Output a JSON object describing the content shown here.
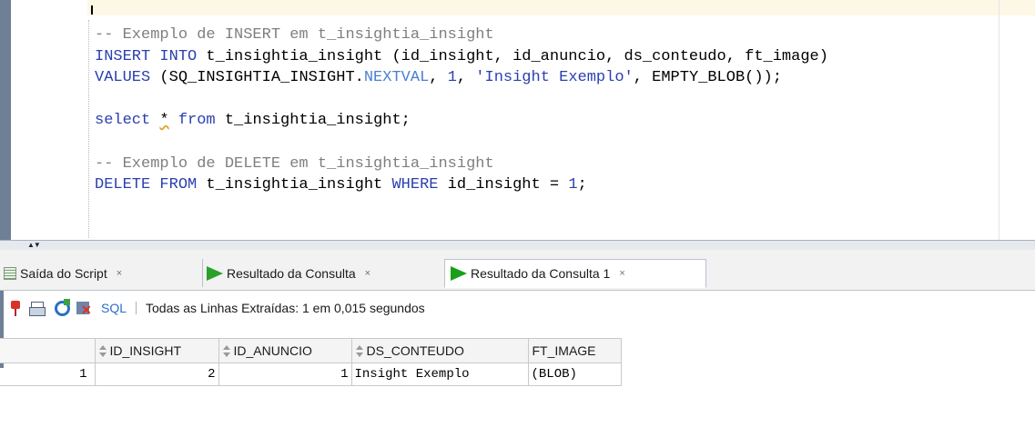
{
  "editor": {
    "lines": [
      [
        {
          "t": "-- Exemplo de INSERT em t_insightia_insight",
          "c": "cm"
        }
      ],
      [
        {
          "t": "INSERT INTO",
          "c": "kw"
        },
        {
          "t": " t_insightia_insight (id_insight, id_anuncio, ds_conteudo, ft_image)",
          "c": ""
        }
      ],
      [
        {
          "t": "VALUES",
          "c": "kw"
        },
        {
          "t": " (SQ_INSIGHTIA_INSIGHT.",
          "c": ""
        },
        {
          "t": "NEXTVAL",
          "c": "fn"
        },
        {
          "t": ", ",
          "c": ""
        },
        {
          "t": "1",
          "c": "num"
        },
        {
          "t": ", ",
          "c": ""
        },
        {
          "t": "'Insight Exemplo'",
          "c": "str"
        },
        {
          "t": ", EMPTY_BLOB());",
          "c": ""
        }
      ],
      [],
      [
        {
          "t": "select",
          "c": "kw"
        },
        {
          "t": " ",
          "c": ""
        },
        {
          "t": "*",
          "c": "squiggle"
        },
        {
          "t": " ",
          "c": ""
        },
        {
          "t": "from",
          "c": "kw"
        },
        {
          "t": " t_insightia_insight;",
          "c": ""
        }
      ],
      [],
      [
        {
          "t": "-- Exemplo de DELETE em t_insightia_insight",
          "c": "cm"
        }
      ],
      [
        {
          "t": "DELETE FROM",
          "c": "kw"
        },
        {
          "t": " t_insightia_insight ",
          "c": ""
        },
        {
          "t": "WHERE",
          "c": "kw"
        },
        {
          "t": " id_insight = ",
          "c": ""
        },
        {
          "t": "1",
          "c": "num"
        },
        {
          "t": ";",
          "c": ""
        }
      ]
    ]
  },
  "splitter": {
    "arrows": "▲▼"
  },
  "tabs": [
    {
      "label": "Saída do Script",
      "close": "×",
      "icon": "script-output-icon",
      "active": false
    },
    {
      "label": "Resultado da Consulta",
      "close": "×",
      "icon": "play-icon",
      "active": false
    },
    {
      "label": "Resultado da Consulta 1",
      "close": "×",
      "icon": "play-icon",
      "active": true
    }
  ],
  "toolbar": {
    "sql_label": "SQL",
    "separator": "|",
    "status": "Todas as Linhas Extraídas: 1 em 0,015 segundos"
  },
  "grid": {
    "columns": [
      "ID_INSIGHT",
      "ID_ANUNCIO",
      "DS_CONTEUDO",
      "FT_IMAGE"
    ],
    "rows": [
      {
        "rownum": "1",
        "cells": [
          "2",
          "1",
          "Insight Exemplo",
          "(BLOB)"
        ]
      }
    ]
  },
  "colors": {
    "keyword": "#2a3fb0",
    "comment": "#7f7f7f",
    "run_green": "#2ba02b"
  }
}
